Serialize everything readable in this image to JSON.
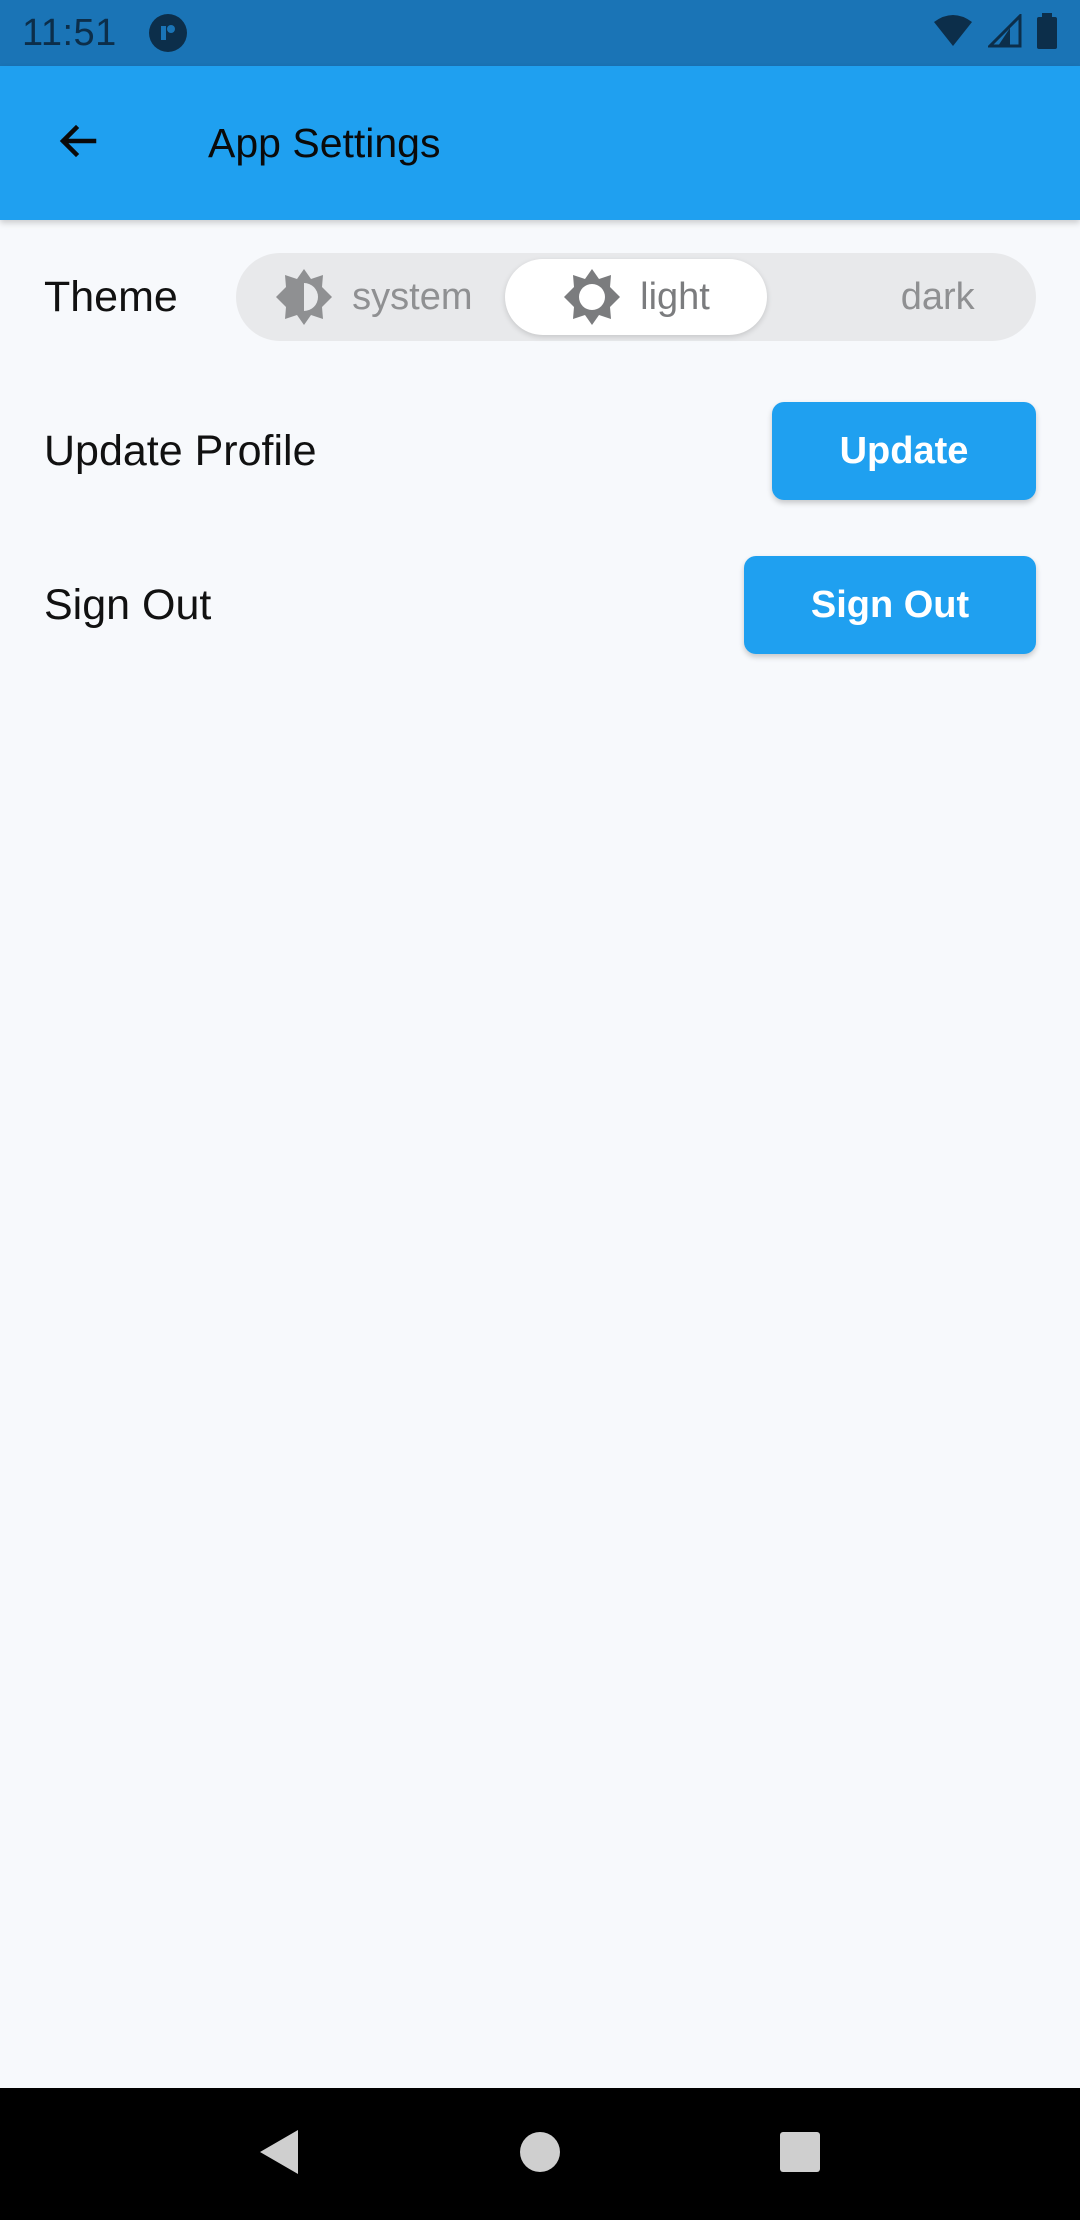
{
  "status_bar": {
    "time": "11:51",
    "icons": [
      "app-notification-icon",
      "wifi-icon",
      "signal-icon",
      "battery-icon"
    ]
  },
  "app_bar": {
    "title": "App Settings",
    "back_icon": "arrow-left-icon"
  },
  "theme_row": {
    "label": "Theme",
    "options": [
      {
        "label": "system",
        "icon": "brightness-auto-icon",
        "selected": false
      },
      {
        "label": "light",
        "icon": "brightness-light-icon",
        "selected": true
      },
      {
        "label": "dark",
        "icon": "moon-icon",
        "selected": false
      }
    ]
  },
  "profile_row": {
    "label": "Update Profile",
    "button": "Update"
  },
  "signout_row": {
    "label": "Sign Out",
    "button": "Sign Out"
  },
  "nav_bar": {
    "items": [
      "back-triangle-icon",
      "home-circle-icon",
      "recents-square-icon"
    ]
  },
  "colors": {
    "status_bar": "#1a74b6",
    "app_bar": "#1fa0f0",
    "button": "#1fa0f0",
    "background": "#f7f9fc"
  }
}
